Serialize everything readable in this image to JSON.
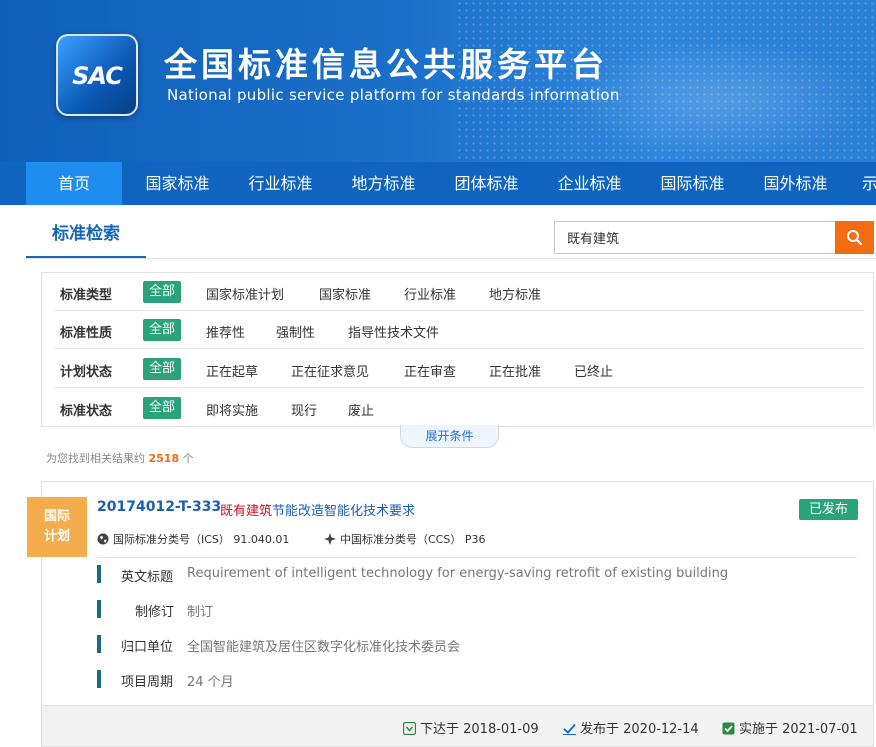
{
  "header": {
    "logo_text": "SAC",
    "title_cn": "全国标准信息公共服务平台",
    "title_en": "National public service platform  for standards information"
  },
  "nav": [
    "首页",
    "国家标准",
    "行业标准",
    "地方标准",
    "团体标准",
    "企业标准",
    "国际标准",
    "国外标准",
    "示"
  ],
  "search": {
    "tab_label": "标准检索",
    "query": "既有建筑"
  },
  "filters": {
    "rows": [
      {
        "label": "标准类型",
        "options": [
          "全部",
          "国家标准计划",
          "国家标准",
          "行业标准",
          "地方标准"
        ]
      },
      {
        "label": "标准性质",
        "options": [
          "全部",
          "推荐性",
          "强制性",
          "指导性技术文件"
        ]
      },
      {
        "label": "计划状态",
        "options": [
          "全部",
          "正在起草",
          "正在征求意见",
          "正在审查",
          "正在批准",
          "已终止"
        ]
      },
      {
        "label": "标准状态",
        "options": [
          "全部",
          "即将实施",
          "现行",
          "废止"
        ]
      }
    ],
    "expand_label": "展开条件"
  },
  "results": {
    "prefix": "为您找到相关结果约",
    "count": "2518",
    "suffix": "个"
  },
  "item": {
    "type_line1": "国际",
    "type_line2": "计划",
    "code": "20174012-T-333",
    "name_highlight": "既有建筑",
    "name_rest": "节能改造智能化技术要求",
    "status": "已发布",
    "ics": "国际标准分类号（ICS） 91.040.01",
    "ccs": "中国标准分类号（CCS） P36",
    "details": [
      {
        "label": "英文标题",
        "value": "Requirement of intelligent technology for energy-saving retrofit of existing building"
      },
      {
        "label": "制修订",
        "value": "制订"
      },
      {
        "label": "归口单位",
        "value": "全国智能建筑及居住区数字化标准化技术委员会"
      },
      {
        "label": "项目周期",
        "value": "24 个月"
      }
    ],
    "dates": {
      "issued": "下达于 2018-01-09",
      "published": "发布于 2020-12-14",
      "implemented": "实施于 2021-07-01"
    }
  },
  "colors": {
    "brand_blue": "#0e64bf",
    "active_nav": "#1f8cf0",
    "accent_orange": "#f36c12",
    "status_green": "#2aa27a",
    "badge_orange": "#f3ad4d"
  }
}
